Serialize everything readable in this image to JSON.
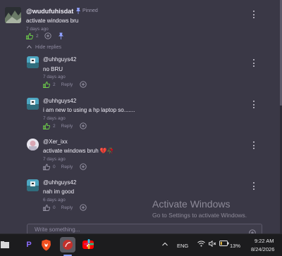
{
  "comment": {
    "author": "@wudufuhisdat",
    "pinned_label": "Pinned",
    "text": "activate windows bru",
    "time": "7 days ago",
    "likes": "2"
  },
  "hide_replies_label": "Hide replies",
  "reply_label": "Reply",
  "replies": [
    {
      "author": "@uhhguys42",
      "text": "no BRU",
      "time": "7 days ago",
      "likes": "2",
      "liked": true
    },
    {
      "author": "@uhhguys42",
      "text": "i am new to using a hp laptop so.......",
      "time": "7 days ago",
      "likes": "2",
      "liked": true
    },
    {
      "author": "@Xer_ixx",
      "text": "activate windows bruh 💔🥀",
      "time": "7 days ago",
      "likes": "0",
      "liked": false
    },
    {
      "author": "@uhhguys42",
      "text": "nah im good",
      "time": "6 days ago",
      "likes": "0",
      "liked": false
    }
  ],
  "watermark": {
    "title": "Activate Windows",
    "subtitle": "Go to Settings to activate Windows."
  },
  "composer": {
    "placeholder": "Write something..."
  },
  "taskbar": {
    "apps": [
      "file-explorer",
      "p-app",
      "brave-browser",
      "red-app",
      "youtube-app",
      "slack-app"
    ],
    "language": "ENG",
    "battery": "13%",
    "time": "9:22 AM",
    "date": "8/24/2026"
  },
  "colors": {
    "background": "#3a3846",
    "like_active": "#6fd44a",
    "pin": "#8fa0ff",
    "taskbar": "#1c1c1e"
  }
}
